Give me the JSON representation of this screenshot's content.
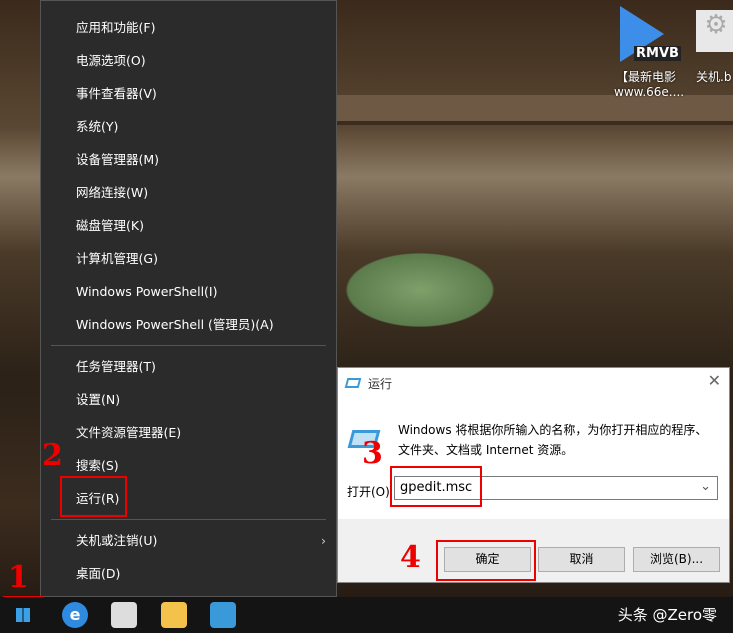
{
  "menu": {
    "items": [
      "应用和功能(F)",
      "电源选项(O)",
      "事件查看器(V)",
      "系统(Y)",
      "设备管理器(M)",
      "网络连接(W)",
      "磁盘管理(K)",
      "计算机管理(G)",
      "Windows PowerShell(I)",
      "Windows PowerShell (管理员)(A)",
      "任务管理器(T)",
      "设置(N)",
      "文件资源管理器(E)",
      "搜索(S)",
      "运行(R)",
      "关机或注销(U)",
      "桌面(D)"
    ]
  },
  "dialog": {
    "title": "运行",
    "description": "Windows 将根据你所输入的名称，为你打开相应的程序、文件夹、文档或 Internet 资源。",
    "open_label": "打开(O)",
    "open_value": "gpedit.msc",
    "ok": "确定",
    "cancel": "取消",
    "browse": "浏览(B)..."
  },
  "steps": [
    "1",
    "2",
    "3",
    "4"
  ],
  "desktop": {
    "icon1_badge": "RMVB",
    "icon1_label1": "【最新电影",
    "icon1_label2": "www.66e....",
    "icon2_label": "关机.b"
  },
  "watermark": "头条 @Zero零",
  "colors": {
    "annotation": "#e00000",
    "menu_bg": "#2b2b2b"
  }
}
